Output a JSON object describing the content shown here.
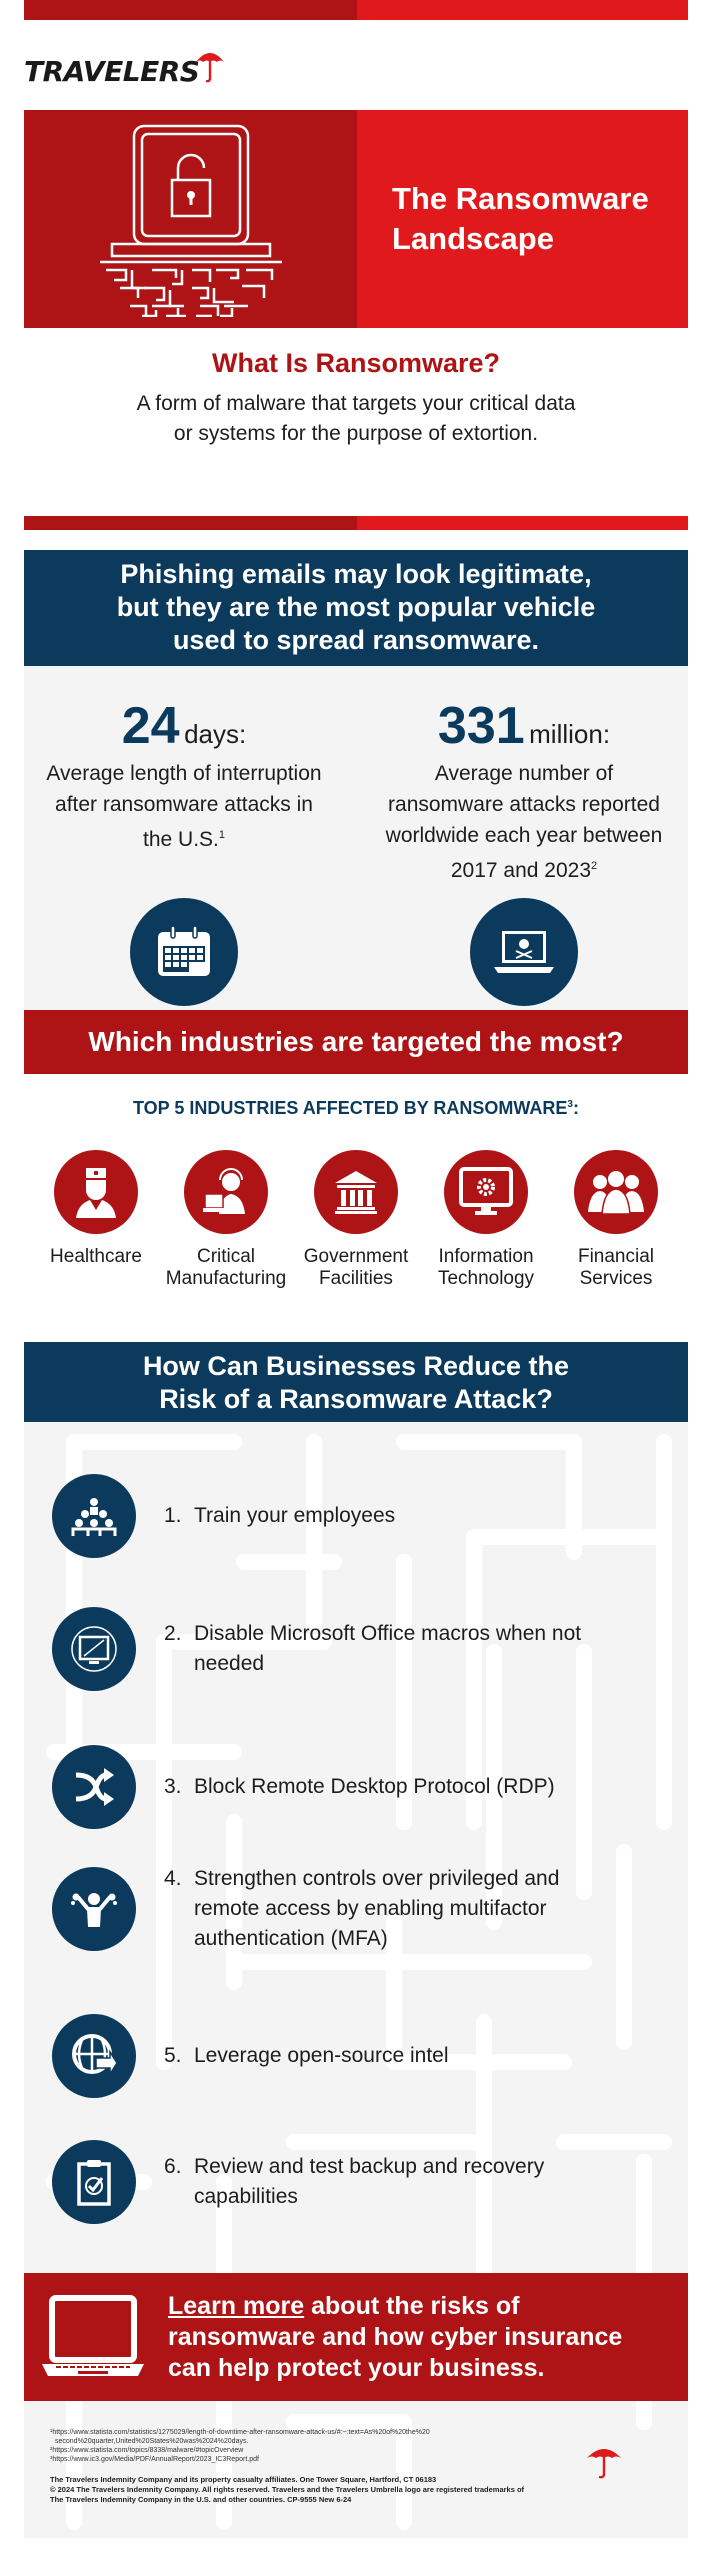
{
  "brand": {
    "name": "TRAVELERS",
    "colors": {
      "dark_red": "#ae1416",
      "red": "#e01a1c",
      "navy": "#0c3a5c",
      "light_gray": "#f4f4f4"
    }
  },
  "hero": {
    "title_line1": "The Ransomware",
    "title_line2": "Landscape",
    "icon": "laptop-lock-maze-icon"
  },
  "what": {
    "heading": "What Is Ransomware?",
    "line1": "A form of malware that targets your critical data",
    "line2": "or systems for the purpose of extortion."
  },
  "phishing": {
    "line1": "Phishing emails may look legitimate,",
    "line2": "but they are the most popular vehicle",
    "line3": "used to spread ransomware."
  },
  "stats": [
    {
      "number": "24",
      "unit": "days:",
      "desc_lines": [
        "Average length of interruption",
        "after ransomware attacks in",
        "the U.S."
      ],
      "footnote": "1",
      "icon": "calendar-icon"
    },
    {
      "number": "331",
      "unit": "million:",
      "desc_lines": [
        "Average number of",
        "ransomware attacks reported",
        "worldwide each year between",
        "2017 and 2023"
      ],
      "footnote": "2",
      "icon": "laptop-skull-icon"
    }
  ],
  "industries": {
    "heading": "Which industries are targeted the most?",
    "subheading": "TOP 5 INDUSTRIES AFFECTED BY RANSOMWARE",
    "sub_footnote": "3",
    "sub_suffix": ":",
    "items": [
      {
        "line1": "Healthcare",
        "line2": "",
        "icon": "nurse-icon"
      },
      {
        "line1": "Critical",
        "line2": "Manufacturing",
        "icon": "worker-laptop-icon"
      },
      {
        "line1": "Government",
        "line2": "Facilities",
        "icon": "government-building-icon"
      },
      {
        "line1": "Information",
        "line2": "Technology",
        "icon": "monitor-gear-icon"
      },
      {
        "line1": "Financial",
        "line2": "Services",
        "icon": "business-people-icon"
      }
    ]
  },
  "risk": {
    "heading_line1": "How Can Businesses Reduce the",
    "heading_line2": "Risk of a Ransomware Attack?",
    "steps": [
      {
        "num": "1.",
        "text": "Train your employees",
        "icon": "group-training-icon"
      },
      {
        "num": "2.",
        "text": "Disable Microsoft Office macros when not needed",
        "icon": "monitor-disabled-icon"
      },
      {
        "num": "3.",
        "text": "Block Remote Desktop Protocol (RDP)",
        "icon": "crossed-arrows-icon"
      },
      {
        "num": "4.",
        "text": "Strengthen controls over privileged and remote access by enabling multifactor authentication (MFA)",
        "icon": "strength-person-icon"
      },
      {
        "num": "5.",
        "text": "Leverage open-source intel",
        "icon": "globe-arrow-icon"
      },
      {
        "num": "6.",
        "text": "Review and test backup and recovery capabilities",
        "icon": "clipboard-check-icon"
      }
    ]
  },
  "cta": {
    "link_text": "Learn more",
    "text_rest1": " about the risks of",
    "line2": "ransomware and how cyber insurance",
    "line3": "can help protect your business.",
    "icon": "laptop-icon"
  },
  "footnotes": [
    "¹https://www.statista.com/statistics/1275029/length-of-downtime-after-ransomware-attack-us/#:~:text=As%20of%20the%20",
    "  second%20quarter,United%20States%20was%2024%20days.",
    "²https://www.statista.com/topics/8338/malware/#topicOverview",
    "³https://www.ic3.gov/Media/PDF/AnnualReport/2023_IC3Report.pdf"
  ],
  "legal": [
    "The Travelers Indemnity Company and its property casualty affiliates. One Tower Square, Hartford, CT 06183",
    "© 2024 The Travelers Indemnity Company. All rights reserved. Travelers and the Travelers Umbrella logo are registered trademarks of",
    "The Travelers Indemnity Company in the U.S. and other countries. CP-9555 New 6-24"
  ]
}
